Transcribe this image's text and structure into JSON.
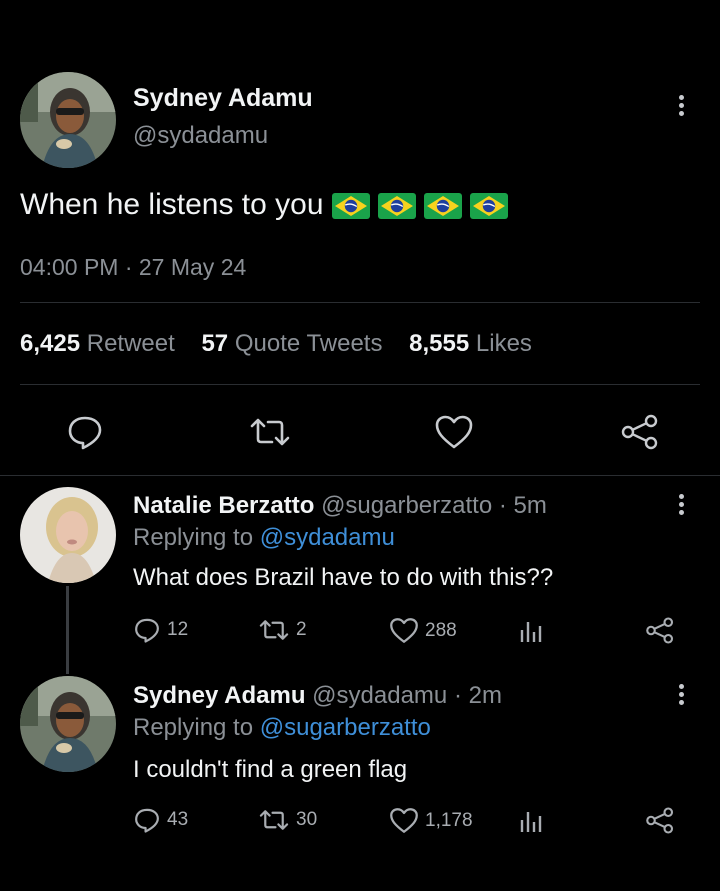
{
  "main_tweet": {
    "author_name": "Sydney Adamu",
    "author_handle": "@sydadamu",
    "text": "When he listens to you",
    "flag_icons": [
      "brazil-flag-icon",
      "brazil-flag-icon",
      "brazil-flag-icon",
      "brazil-flag-icon"
    ],
    "timestamp": "04:00 PM · 27 May 24",
    "stats": {
      "retweets_count": "6,425",
      "retweets_label": "Retweet",
      "quotes_count": "57",
      "quotes_label": "Quote Tweets",
      "likes_count": "8,555",
      "likes_label": "Likes"
    },
    "actions": [
      "reply-icon",
      "retweet-icon",
      "like-icon",
      "share-icon"
    ]
  },
  "replies": [
    {
      "author_name": "Natalie Berzatto",
      "author_handle": "@sugarberzatto",
      "time": "· 5m",
      "replying_prefix": "Replying to",
      "replying_to": "@sydadamu",
      "text": "What does Brazil have to do with this??",
      "reply_count": "12",
      "retweet_count": "2",
      "like_count": "288"
    },
    {
      "author_name": "Sydney Adamu",
      "author_handle": "@sydadamu",
      "time": "· 2m",
      "replying_prefix": "Replying to",
      "replying_to": "@sugarberzatto",
      "text": "I couldn't find a green flag",
      "reply_count": "43",
      "retweet_count": "30",
      "like_count": "1,178"
    }
  ],
  "colors": {
    "background": "#000000",
    "text": "#e7e9ea",
    "muted": "#8b9096",
    "link": "#3f8fd8",
    "divider": "#2a2d31"
  }
}
